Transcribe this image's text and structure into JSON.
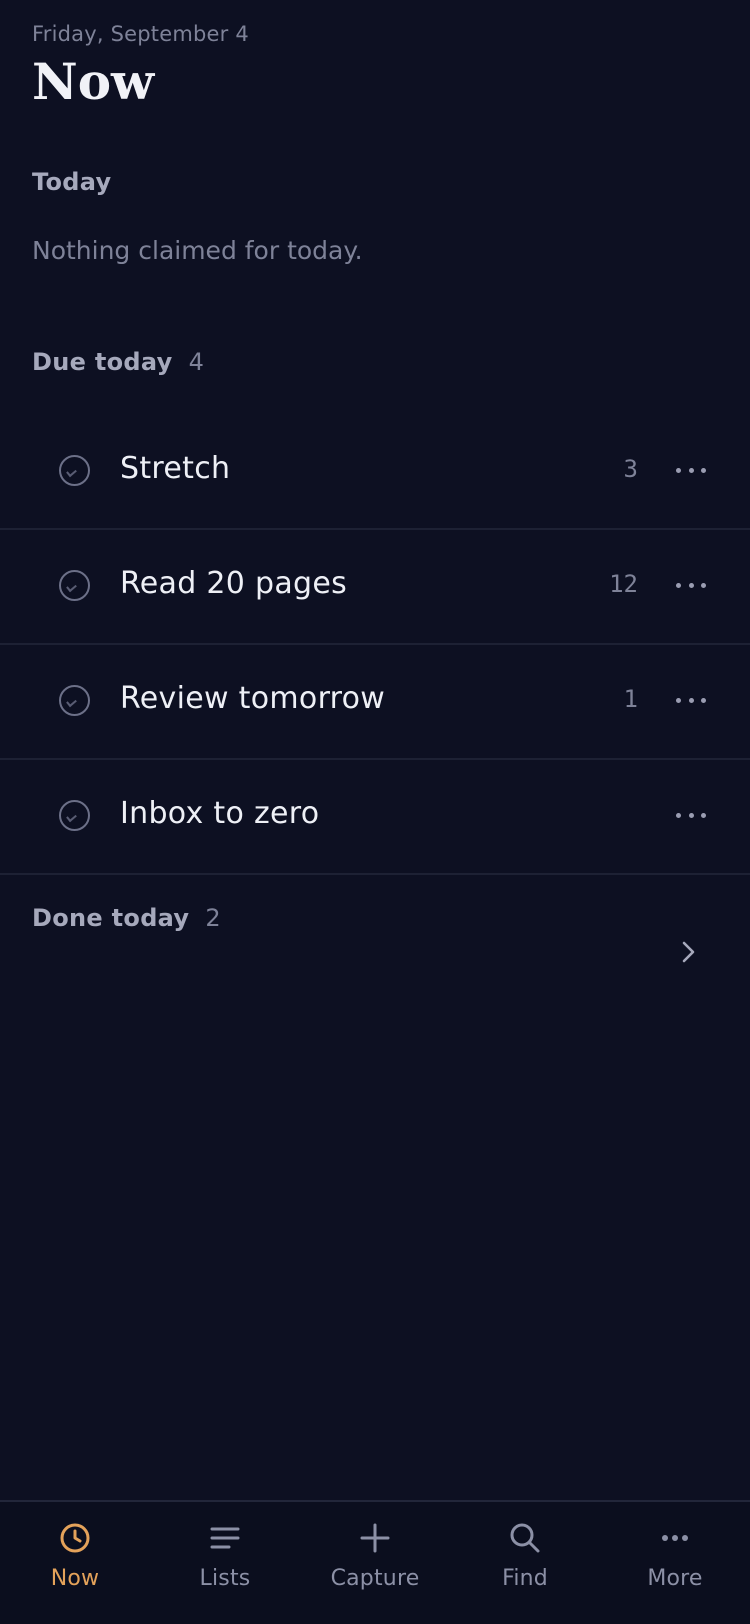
{
  "header": {
    "date": "Friday, September 4",
    "title": "Now"
  },
  "today": {
    "label": "Today",
    "empty_message": "Nothing claimed for today."
  },
  "due_today": {
    "label": "Due today",
    "count": "4",
    "tasks": [
      {
        "name": "Stretch",
        "count": "3"
      },
      {
        "name": "Read 20 pages",
        "count": "12"
      },
      {
        "name": "Review tomorrow",
        "count": "1"
      },
      {
        "name": "Inbox to zero",
        "count": ""
      }
    ]
  },
  "done_today": {
    "label": "Done today",
    "count": "2"
  },
  "tabs": [
    {
      "label": "Now",
      "icon": "clock-icon",
      "active": true
    },
    {
      "label": "Lists",
      "icon": "lines-icon",
      "active": false
    },
    {
      "label": "Capture",
      "icon": "plus-icon",
      "active": false
    },
    {
      "label": "Find",
      "icon": "search-icon",
      "active": false
    },
    {
      "label": "More",
      "icon": "dots-icon",
      "active": false
    }
  ],
  "colors": {
    "background": "#0d1022",
    "accent": "#e4a25a",
    "muted": "#7e8298"
  }
}
